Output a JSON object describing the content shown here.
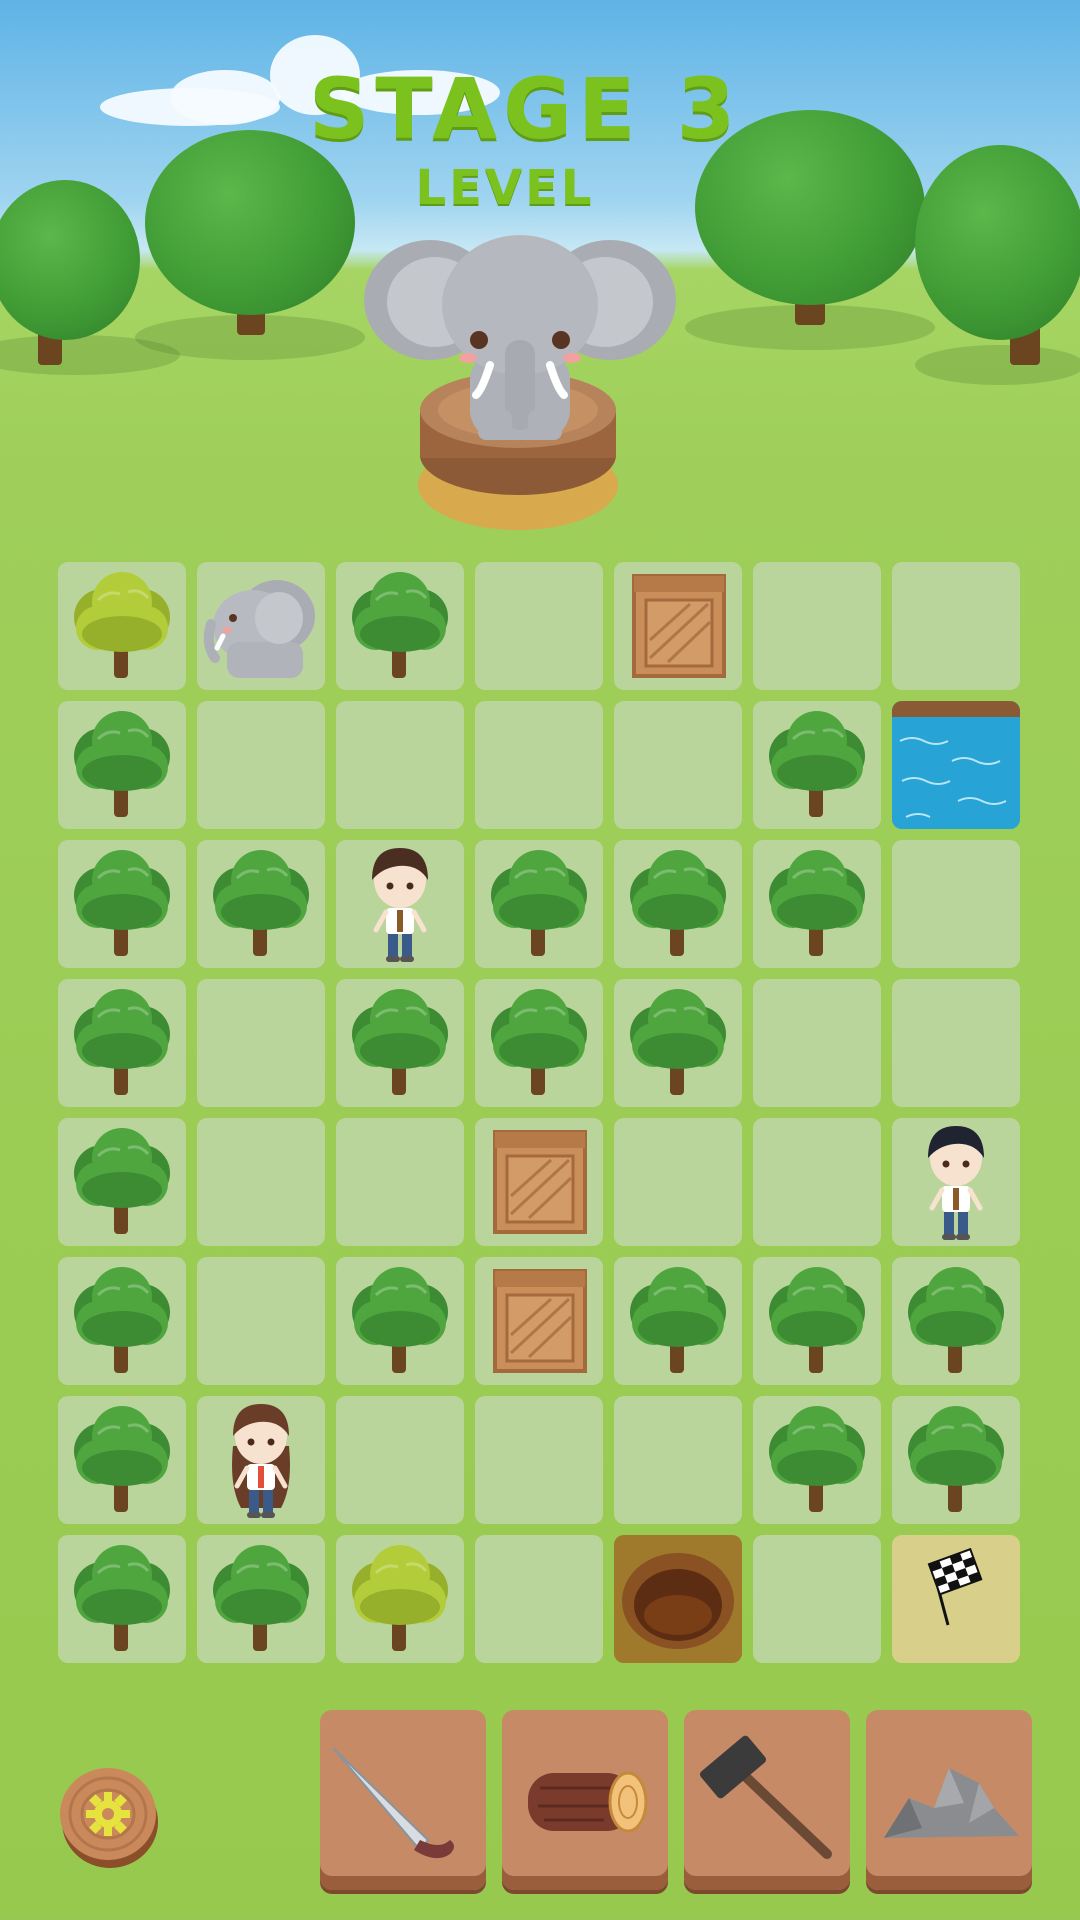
{
  "header": {
    "title": "STAGE 3",
    "subtitle": "LEVEL"
  },
  "hero": {
    "icon": "elephant-on-pedestal-icon"
  },
  "board": {
    "columns": 7,
    "rows": 8,
    "cells": [
      [
        "tree-light",
        "elephant",
        "tree",
        "empty",
        "crate",
        "empty",
        "empty"
      ],
      [
        "tree",
        "empty",
        "empty",
        "empty",
        "empty",
        "tree",
        "water"
      ],
      [
        "tree",
        "tree",
        "boy-brown-hair",
        "tree",
        "tree",
        "tree",
        "empty"
      ],
      [
        "tree",
        "empty",
        "tree",
        "tree",
        "tree",
        "empty",
        "empty"
      ],
      [
        "tree",
        "empty",
        "empty",
        "crate",
        "empty",
        "empty",
        "boy-black-hair"
      ],
      [
        "tree",
        "empty",
        "tree",
        "crate",
        "tree",
        "tree",
        "tree"
      ],
      [
        "tree",
        "girl",
        "empty",
        "empty",
        "empty",
        "tree",
        "tree"
      ],
      [
        "tree",
        "tree",
        "tree-light",
        "empty",
        "hole",
        "empty",
        "finish-flag"
      ]
    ]
  },
  "toolbar": {
    "settings_icon": "gear-icon",
    "tools": [
      {
        "name": "machete",
        "icon": "machete-icon"
      },
      {
        "name": "log",
        "icon": "log-icon"
      },
      {
        "name": "hammer",
        "icon": "hammer-icon"
      },
      {
        "name": "rocks",
        "icon": "rocks-icon"
      }
    ]
  },
  "colors": {
    "title_green": "#7bc21f",
    "tile": "#b9d59b",
    "goal_tile": "#d8d08a",
    "tool_panel": "#c68a66"
  }
}
